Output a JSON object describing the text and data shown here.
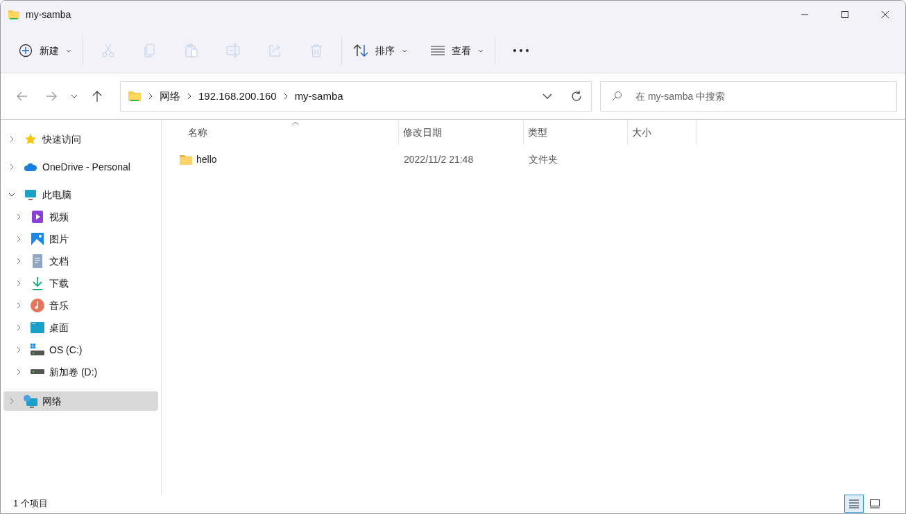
{
  "window": {
    "title": "my-samba"
  },
  "toolbar": [
    {
      "kind": "new",
      "label": "新建",
      "disabled": false
    },
    {
      "kind": "cut",
      "disabled": true
    },
    {
      "kind": "copy",
      "disabled": true
    },
    {
      "kind": "paste",
      "disabled": true
    },
    {
      "kind": "rename",
      "disabled": true
    },
    {
      "kind": "share",
      "disabled": true
    },
    {
      "kind": "delete",
      "disabled": true
    },
    {
      "kind": "sort",
      "label": "排序",
      "disabled": false
    },
    {
      "kind": "view",
      "label": "查看",
      "disabled": false
    },
    {
      "kind": "more",
      "disabled": false
    }
  ],
  "navigation": {
    "back_disabled": true,
    "forward_disabled": true
  },
  "breadcrumb": [
    "网络",
    "192.168.200.160",
    "my-samba"
  ],
  "search": {
    "placeholder": "在 my-samba 中搜索"
  },
  "sidebar": {
    "items": [
      {
        "label": "快速访问",
        "expanded": false,
        "selected": false
      },
      {
        "label": "OneDrive - Personal",
        "expanded": false,
        "selected": false
      },
      {
        "label": "此电脑",
        "expanded": true,
        "selected": false,
        "children": [
          {
            "label": "视频",
            "expanded": false,
            "selected": false
          },
          {
            "label": "图片",
            "expanded": false,
            "selected": false
          },
          {
            "label": "文档",
            "expanded": false,
            "selected": false
          },
          {
            "label": "下载",
            "expanded": false,
            "selected": false
          },
          {
            "label": "音乐",
            "expanded": false,
            "selected": false
          },
          {
            "label": "桌面",
            "expanded": false,
            "selected": false
          },
          {
            "label": "OS (C:)",
            "expanded": false,
            "selected": false
          },
          {
            "label": "新加卷 (D:)",
            "expanded": false,
            "selected": false
          }
        ]
      },
      {
        "label": "网络",
        "expanded": false,
        "selected": true
      }
    ]
  },
  "table": {
    "columns": [
      {
        "label": "名称",
        "sorted": true
      },
      {
        "label": "修改日期",
        "sorted": false
      },
      {
        "label": "类型",
        "sorted": false
      },
      {
        "label": "大小",
        "sorted": false
      }
    ],
    "rows": [
      {
        "name": "hello",
        "modified": "2022/11/2 21:48",
        "type": "文件夹",
        "selected": false
      }
    ]
  },
  "status_bar": {
    "count": "1 个项目"
  },
  "view_buttons": [
    {
      "kind": "details",
      "selected": true
    },
    {
      "kind": "tiles",
      "selected": false
    }
  ]
}
